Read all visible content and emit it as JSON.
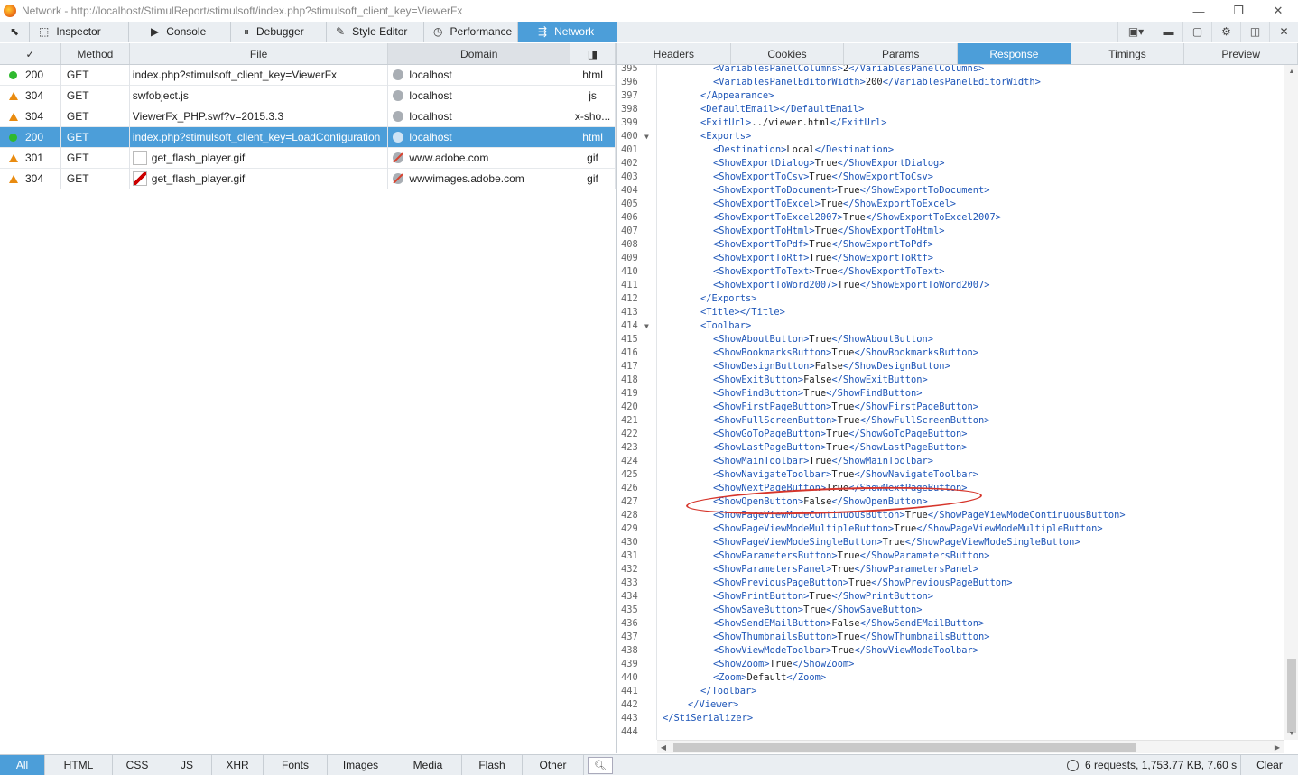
{
  "window": {
    "title": "Network - http://localhost/StimulReport/stimulsoft/index.php?stimulsoft_client_key=ViewerFx",
    "controls": [
      "—",
      "❐",
      "✕"
    ]
  },
  "toolbar": {
    "tabs": [
      {
        "label": "Inspector",
        "icon": "inspector-icon",
        "glyph": "⬚"
      },
      {
        "label": "Console",
        "icon": "console-icon",
        "glyph": "▶"
      },
      {
        "label": "Debugger",
        "icon": "debugger-icon",
        "glyph": "⏸"
      },
      {
        "label": "Style Editor",
        "icon": "style-editor-icon",
        "glyph": "✎"
      },
      {
        "label": "Performance",
        "icon": "performance-icon",
        "glyph": "◷"
      },
      {
        "label": "Network",
        "icon": "network-icon",
        "glyph": "⇶",
        "active": true
      }
    ],
    "right_icons": [
      {
        "name": "responsive-design-icon",
        "glyph": "▣▾"
      },
      {
        "name": "scratchpad-icon",
        "glyph": "▬"
      },
      {
        "name": "screenshot-icon",
        "glyph": "▢"
      },
      {
        "name": "settings-icon",
        "glyph": "⚙"
      },
      {
        "name": "dock-side-icon",
        "glyph": "◫"
      },
      {
        "name": "close-toolbox-icon",
        "glyph": "✕"
      }
    ]
  },
  "requests": {
    "columns": {
      "status": "✓",
      "method": "Method",
      "file": "File",
      "domain": "Domain",
      "type": "◨"
    },
    "rows": [
      {
        "state": "ok",
        "status": "200",
        "method": "GET",
        "file": "index.php?stimulsoft_client_key=ViewerFx",
        "domain": "localhost",
        "domain_icon": "globe",
        "type": "html",
        "thumb": ""
      },
      {
        "state": "warn",
        "status": "304",
        "method": "GET",
        "file": "swfobject.js",
        "domain": "localhost",
        "domain_icon": "globe",
        "type": "js",
        "thumb": ""
      },
      {
        "state": "warn",
        "status": "304",
        "method": "GET",
        "file": "ViewerFx_PHP.swf?v=2015.3.3",
        "domain": "localhost",
        "domain_icon": "globe",
        "type": "x-sho...",
        "thumb": ""
      },
      {
        "state": "ok",
        "status": "200",
        "method": "GET",
        "file": "index.php?stimulsoft_client_key=LoadConfiguration",
        "domain": "localhost",
        "domain_icon": "globe",
        "type": "html",
        "thumb": "",
        "selected": true
      },
      {
        "state": "warn",
        "status": "301",
        "method": "GET",
        "file": "get_flash_player.gif",
        "domain": "www.adobe.com",
        "domain_icon": "blocked",
        "type": "gif",
        "thumb": "blank"
      },
      {
        "state": "warn",
        "status": "304",
        "method": "GET",
        "file": "get_flash_player.gif",
        "domain": "wwwimages.adobe.com",
        "domain_icon": "blocked",
        "type": "gif",
        "thumb": "flash"
      }
    ]
  },
  "detail": {
    "tabs": [
      "Headers",
      "Cookies",
      "Params",
      "Response",
      "Timings",
      "Preview"
    ],
    "active_tab": "Response",
    "first_line": 395,
    "lines": [
      {
        "n": "395",
        "indent": 4,
        "open": "<VariablesPanelColumns>",
        "text": "2",
        "close": "</VariablesPanelColumns>"
      },
      {
        "n": "396",
        "indent": 4,
        "open": "<VariablesPanelEditorWidth>",
        "text": "200",
        "close": "</VariablesPanelEditorWidth>"
      },
      {
        "n": "397",
        "indent": 3,
        "open": "</Appearance>",
        "text": "",
        "close": ""
      },
      {
        "n": "398",
        "indent": 3,
        "open": "<DefaultEmail>",
        "text": "",
        "close": "</DefaultEmail>"
      },
      {
        "n": "399",
        "indent": 3,
        "open": "<ExitUrl>",
        "text": "../viewer.html",
        "close": "</ExitUrl>"
      },
      {
        "n": "400",
        "indent": 3,
        "open": "<Exports>",
        "text": "",
        "close": "",
        "fold": true
      },
      {
        "n": "401",
        "indent": 4,
        "open": "<Destination>",
        "text": "Local",
        "close": "</Destination>"
      },
      {
        "n": "402",
        "indent": 4,
        "open": "<ShowExportDialog>",
        "text": "True",
        "close": "</ShowExportDialog>"
      },
      {
        "n": "403",
        "indent": 4,
        "open": "<ShowExportToCsv>",
        "text": "True",
        "close": "</ShowExportToCsv>"
      },
      {
        "n": "404",
        "indent": 4,
        "open": "<ShowExportToDocument>",
        "text": "True",
        "close": "</ShowExportToDocument>"
      },
      {
        "n": "405",
        "indent": 4,
        "open": "<ShowExportToExcel>",
        "text": "True",
        "close": "</ShowExportToExcel>"
      },
      {
        "n": "406",
        "indent": 4,
        "open": "<ShowExportToExcel2007>",
        "text": "True",
        "close": "</ShowExportToExcel2007>"
      },
      {
        "n": "407",
        "indent": 4,
        "open": "<ShowExportToHtml>",
        "text": "True",
        "close": "</ShowExportToHtml>"
      },
      {
        "n": "408",
        "indent": 4,
        "open": "<ShowExportToPdf>",
        "text": "True",
        "close": "</ShowExportToPdf>"
      },
      {
        "n": "409",
        "indent": 4,
        "open": "<ShowExportToRtf>",
        "text": "True",
        "close": "</ShowExportToRtf>"
      },
      {
        "n": "410",
        "indent": 4,
        "open": "<ShowExportToText>",
        "text": "True",
        "close": "</ShowExportToText>"
      },
      {
        "n": "411",
        "indent": 4,
        "open": "<ShowExportToWord2007>",
        "text": "True",
        "close": "</ShowExportToWord2007>"
      },
      {
        "n": "412",
        "indent": 3,
        "open": "</Exports>",
        "text": "",
        "close": ""
      },
      {
        "n": "413",
        "indent": 3,
        "open": "<Title>",
        "text": "",
        "close": "</Title>"
      },
      {
        "n": "414",
        "indent": 3,
        "open": "<Toolbar>",
        "text": "",
        "close": "",
        "fold": true
      },
      {
        "n": "415",
        "indent": 4,
        "open": "<ShowAboutButton>",
        "text": "True",
        "close": "</ShowAboutButton>"
      },
      {
        "n": "416",
        "indent": 4,
        "open": "<ShowBookmarksButton>",
        "text": "True",
        "close": "</ShowBookmarksButton>"
      },
      {
        "n": "417",
        "indent": 4,
        "open": "<ShowDesignButton>",
        "text": "False",
        "close": "</ShowDesignButton>"
      },
      {
        "n": "418",
        "indent": 4,
        "open": "<ShowExitButton>",
        "text": "False",
        "close": "</ShowExitButton>"
      },
      {
        "n": "419",
        "indent": 4,
        "open": "<ShowFindButton>",
        "text": "True",
        "close": "</ShowFindButton>"
      },
      {
        "n": "420",
        "indent": 4,
        "open": "<ShowFirstPageButton>",
        "text": "True",
        "close": "</ShowFirstPageButton>"
      },
      {
        "n": "421",
        "indent": 4,
        "open": "<ShowFullScreenButton>",
        "text": "True",
        "close": "</ShowFullScreenButton>"
      },
      {
        "n": "422",
        "indent": 4,
        "open": "<ShowGoToPageButton>",
        "text": "True",
        "close": "</ShowGoToPageButton>"
      },
      {
        "n": "423",
        "indent": 4,
        "open": "<ShowLastPageButton>",
        "text": "True",
        "close": "</ShowLastPageButton>"
      },
      {
        "n": "424",
        "indent": 4,
        "open": "<ShowMainToolbar>",
        "text": "True",
        "close": "</ShowMainToolbar>"
      },
      {
        "n": "425",
        "indent": 4,
        "open": "<ShowNavigateToolbar>",
        "text": "True",
        "close": "</ShowNavigateToolbar>"
      },
      {
        "n": "426",
        "indent": 4,
        "open": "<ShowNextPageButton>",
        "text": "True",
        "close": "</ShowNextPageButton>"
      },
      {
        "n": "427",
        "indent": 4,
        "open": "<ShowOpenButton>",
        "text": "False",
        "close": "</ShowOpenButton>",
        "highlight": true
      },
      {
        "n": "428",
        "indent": 4,
        "open": "<ShowPageViewModeContinuousButton>",
        "text": "True",
        "close": "</ShowPageViewModeContinuousButton>"
      },
      {
        "n": "429",
        "indent": 4,
        "open": "<ShowPageViewModeMultipleButton>",
        "text": "True",
        "close": "</ShowPageViewModeMultipleButton>"
      },
      {
        "n": "430",
        "indent": 4,
        "open": "<ShowPageViewModeSingleButton>",
        "text": "True",
        "close": "</ShowPageViewModeSingleButton>"
      },
      {
        "n": "431",
        "indent": 4,
        "open": "<ShowParametersButton>",
        "text": "True",
        "close": "</ShowParametersButton>"
      },
      {
        "n": "432",
        "indent": 4,
        "open": "<ShowParametersPanel>",
        "text": "True",
        "close": "</ShowParametersPanel>"
      },
      {
        "n": "433",
        "indent": 4,
        "open": "<ShowPreviousPageButton>",
        "text": "True",
        "close": "</ShowPreviousPageButton>"
      },
      {
        "n": "434",
        "indent": 4,
        "open": "<ShowPrintButton>",
        "text": "True",
        "close": "</ShowPrintButton>"
      },
      {
        "n": "435",
        "indent": 4,
        "open": "<ShowSaveButton>",
        "text": "True",
        "close": "</ShowSaveButton>"
      },
      {
        "n": "436",
        "indent": 4,
        "open": "<ShowSendEMailButton>",
        "text": "False",
        "close": "</ShowSendEMailButton>"
      },
      {
        "n": "437",
        "indent": 4,
        "open": "<ShowThumbnailsButton>",
        "text": "True",
        "close": "</ShowThumbnailsButton>"
      },
      {
        "n": "438",
        "indent": 4,
        "open": "<ShowViewModeToolbar>",
        "text": "True",
        "close": "</ShowViewModeToolbar>"
      },
      {
        "n": "439",
        "indent": 4,
        "open": "<ShowZoom>",
        "text": "True",
        "close": "</ShowZoom>"
      },
      {
        "n": "440",
        "indent": 4,
        "open": "<Zoom>",
        "text": "Default",
        "close": "</Zoom>"
      },
      {
        "n": "441",
        "indent": 3,
        "open": "</Toolbar>",
        "text": "",
        "close": ""
      },
      {
        "n": "442",
        "indent": 2,
        "open": "</Viewer>",
        "text": "",
        "close": ""
      },
      {
        "n": "443",
        "indent": 0,
        "open": "</StiSerializer>",
        "text": "",
        "close": ""
      },
      {
        "n": "444",
        "indent": 0,
        "open": "",
        "text": "",
        "close": ""
      }
    ]
  },
  "footer": {
    "filters": [
      "All",
      "HTML",
      "CSS",
      "JS",
      "XHR",
      "Fonts",
      "Images",
      "Media",
      "Flash",
      "Other"
    ],
    "active_filter": "All",
    "summary": "6 requests, 1,753.77 KB, 7.60 s",
    "clear_label": "Clear"
  },
  "colors": {
    "accent": "#4c9ed9",
    "ok": "#2fb92f",
    "warn": "#e98b10",
    "xml_tag": "#1e56b8",
    "annotation": "#d6352b"
  }
}
